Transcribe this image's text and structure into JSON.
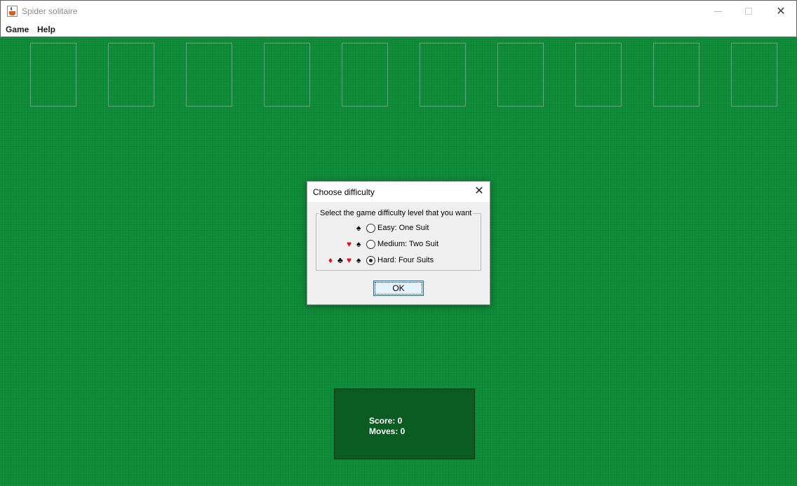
{
  "window": {
    "title": "Spider solitaire",
    "close_glyph": "✕"
  },
  "menu": {
    "items": [
      "Game",
      "Help"
    ]
  },
  "table": {
    "background": "#0c8a37",
    "foundation_slots": 10
  },
  "score_panel": {
    "score": "Score: 0",
    "moves": "Moves: 0"
  },
  "dialog": {
    "title": "Choose difficulty",
    "close_glyph": "✕",
    "group_label": "Select the game difficulty level that you want",
    "options": [
      {
        "label": "Easy: One Suit",
        "suits": [
          "♠"
        ],
        "selected": false
      },
      {
        "label": "Medium: Two Suit",
        "suits": [
          "♥",
          "♠"
        ],
        "selected": false
      },
      {
        "label": "Hard: Four Suits",
        "suits": [
          "♦",
          "♣",
          "♥",
          "♠"
        ],
        "selected": true
      }
    ],
    "ok_label": "OK"
  },
  "colors": {
    "felt": "#0c8a37",
    "score_panel": "#0b5c22",
    "red_suit": "#e0111b",
    "black_suit": "#000000"
  }
}
